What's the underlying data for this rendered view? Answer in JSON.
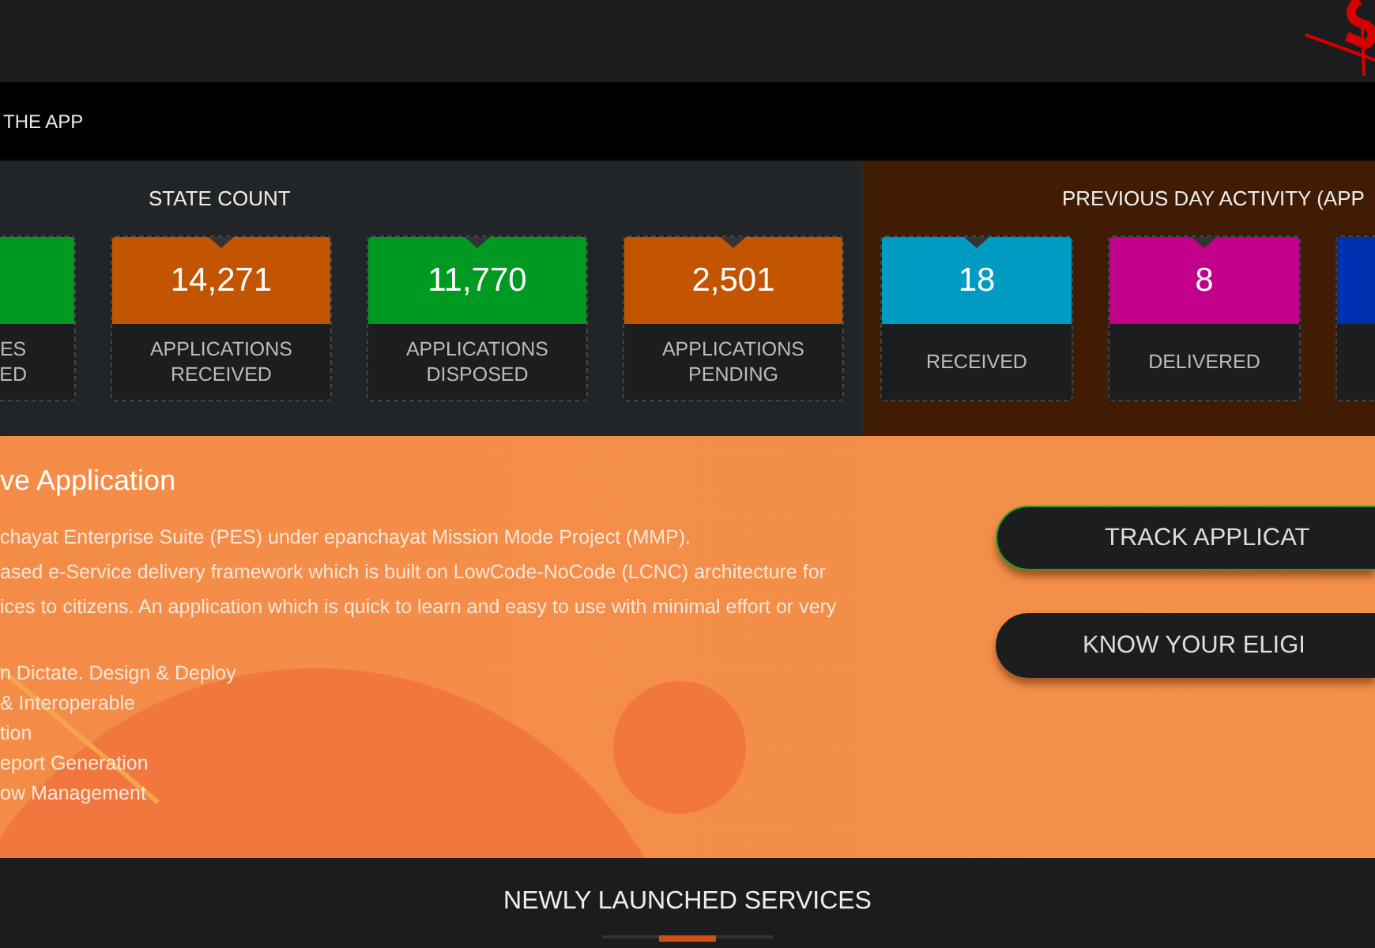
{
  "nav": {
    "label": "THE APP"
  },
  "state_count": {
    "title": "STATE COUNT",
    "cards": [
      {
        "kind": "edge",
        "label": [
          "ES",
          "ED"
        ],
        "color": "#009a22"
      },
      {
        "kind": "full",
        "value": "14,271",
        "label": [
          "APPLICATIONS",
          "RECEIVED"
        ],
        "color": "#c45500"
      },
      {
        "kind": "full",
        "value": "11,770",
        "label": [
          "APPLICATIONS",
          "DISPOSED"
        ],
        "color": "#009a22"
      },
      {
        "kind": "full",
        "value": "2,501",
        "label": [
          "APPLICATIONS",
          "PENDING"
        ],
        "color": "#c45500"
      }
    ]
  },
  "previous_day": {
    "title": "PREVIOUS DAY ACTIVITY (APP",
    "cards": [
      {
        "kind": "full",
        "value": "18",
        "label": [
          "RECEIVED"
        ],
        "color": "#009bc2"
      },
      {
        "kind": "full",
        "value": "8",
        "label": [
          "DELIVERED"
        ],
        "color": "#c2008a"
      },
      {
        "kind": "edge",
        "color": "#0030b0"
      }
    ]
  },
  "about": {
    "heading": "ve Application",
    "paragraph_lines": [
      "chayat Enterprise Suite (PES) under epanchayat Mission Mode Project (MMP).",
      "ased e-Service delivery framework which is built on LowCode-NoCode (LCNC) architecture for",
      "ices to citizens. An application which is quick to learn and easy to use with minimal effort or very"
    ],
    "features": [
      "n Dictate. Design & Deploy",
      "& Interoperable",
      "tion",
      "eport Generation",
      "ow Management"
    ],
    "buttons": [
      {
        "label": "TRACK APPLICAT",
        "selected": true
      },
      {
        "label": "KNOW YOUR ELIGI",
        "selected": false
      }
    ]
  },
  "services": {
    "title": "NEWLY LAUNCHED SERVICES"
  }
}
